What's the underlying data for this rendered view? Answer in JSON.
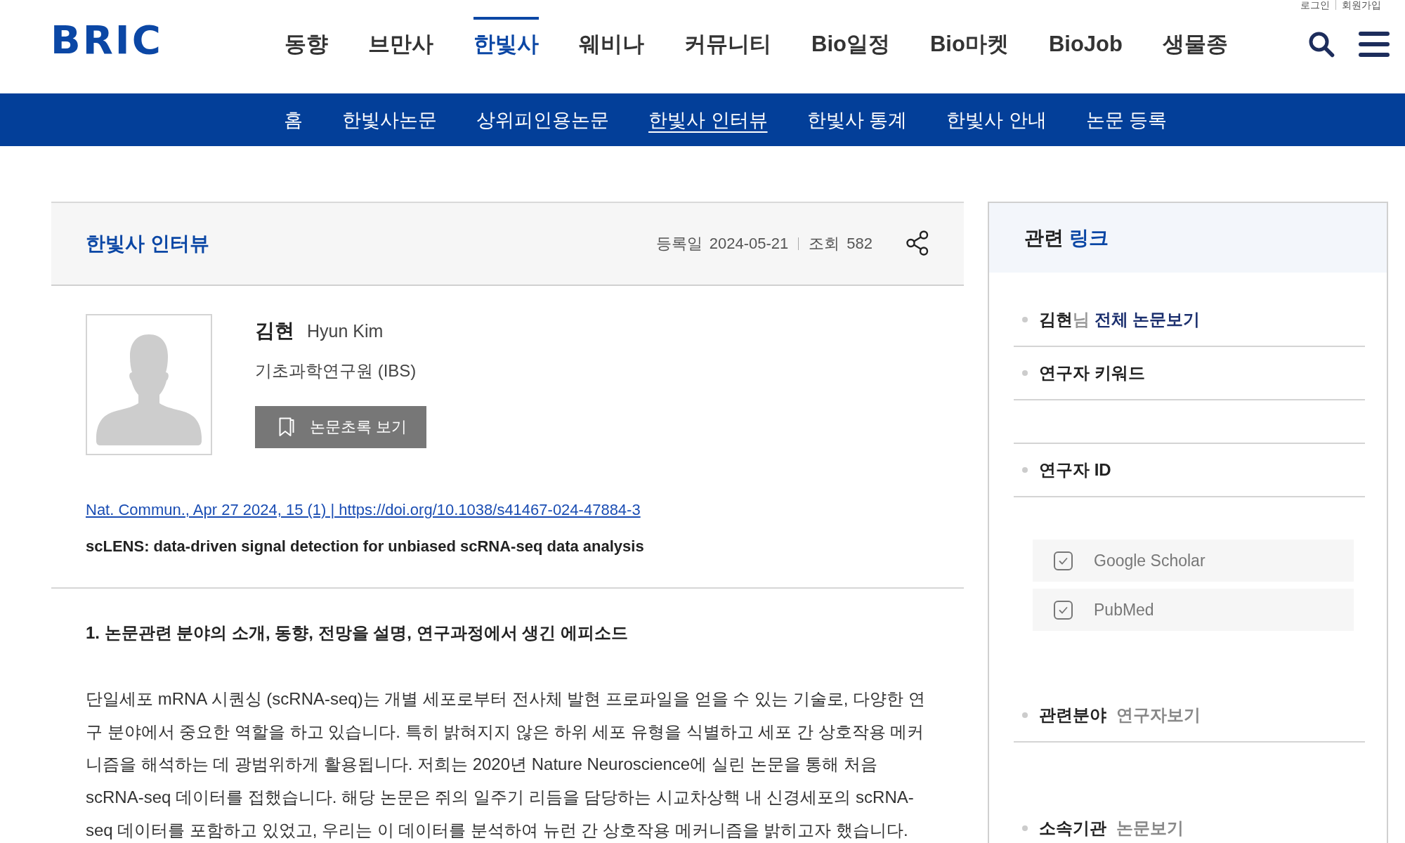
{
  "header": {
    "logo": "BRIC",
    "utility_links": [
      "로그인",
      "회원가입"
    ],
    "nav": [
      {
        "label": "동향",
        "selected": false
      },
      {
        "label": "브만사",
        "selected": false
      },
      {
        "label": "한빛사",
        "selected": true
      },
      {
        "label": "웨비나",
        "selected": false
      },
      {
        "label": "커뮤니티",
        "selected": false
      },
      {
        "label": "Bio일정",
        "selected": false
      },
      {
        "label": "Bio마켓",
        "selected": false
      },
      {
        "label": "BioJob",
        "selected": false
      },
      {
        "label": "생물종",
        "selected": false
      }
    ]
  },
  "subnav": [
    {
      "label": "홈",
      "selected": false
    },
    {
      "label": "한빛사논문",
      "selected": false
    },
    {
      "label": "상위피인용논문",
      "selected": false
    },
    {
      "label": "한빛사 인터뷰",
      "selected": true
    },
    {
      "label": "한빛사 통계",
      "selected": false
    },
    {
      "label": "한빛사 안내",
      "selected": false
    },
    {
      "label": "논문 등록",
      "selected": false
    }
  ],
  "article": {
    "section_title": "한빛사 인터뷰",
    "date_label": "등록일",
    "date": "2024-05-21",
    "views_label": "조회",
    "views": "582",
    "researcher": {
      "name_ko": "김현",
      "name_en": "Hyun Kim",
      "affiliation": "기초과학연구원 (IBS)",
      "abstract_button": "논문초록 보기"
    },
    "citation": "Nat. Commun., Apr 27 2024, 15 (1) | https://doi.org/10.1038/s41467-024-47884-3",
    "paper_title": "scLENS: data-driven signal detection for unbiased scRNA-seq data analysis",
    "question": "1. 논문관련 분야의 소개, 동향, 전망을 설명, 연구과정에서 생긴 에피소드",
    "answer": "단일세포 mRNA 시퀀싱 (scRNA-seq)는 개별 세포로부터 전사체 발현 프로파일을 얻을 수 있는 기술로, 다양한 연구 분야에서 중요한 역할을 하고 있습니다. 특히 밝혀지지 않은 하위 세포 유형을 식별하고 세포 간 상호작용 메커니즘을 해석하는 데 광범위하게 활용됩니다. 저희는 2020년 Nature Neuroscience에 실린 논문을 통해 처음 scRNA-seq 데이터를 접했습니다. 해당 논문은 쥐의 일주기 리듬을 담당하는 시교차상핵 내 신경세포의 scRNA-seq 데이터를 포함하고 있었고, 우리는 이 데이터를 분석하여 뉴런 간 상호작용 메커니즘을 밝히고자 했습니다."
  },
  "sidebar": {
    "title": "관련",
    "title_highlight": "링크",
    "items": [
      {
        "kind": "papers",
        "name": "김현",
        "honorific": "님",
        "link": "전체 논문보기"
      },
      {
        "kind": "keywords",
        "label": "연구자 키워드"
      },
      {
        "kind": "ids",
        "label": "연구자 ID",
        "links": [
          "Google Scholar",
          "PubMed"
        ]
      },
      {
        "kind": "field",
        "label": "관련분야",
        "link": "연구자보기"
      },
      {
        "kind": "field",
        "label": "소속기관",
        "link": "논문보기"
      }
    ]
  }
}
